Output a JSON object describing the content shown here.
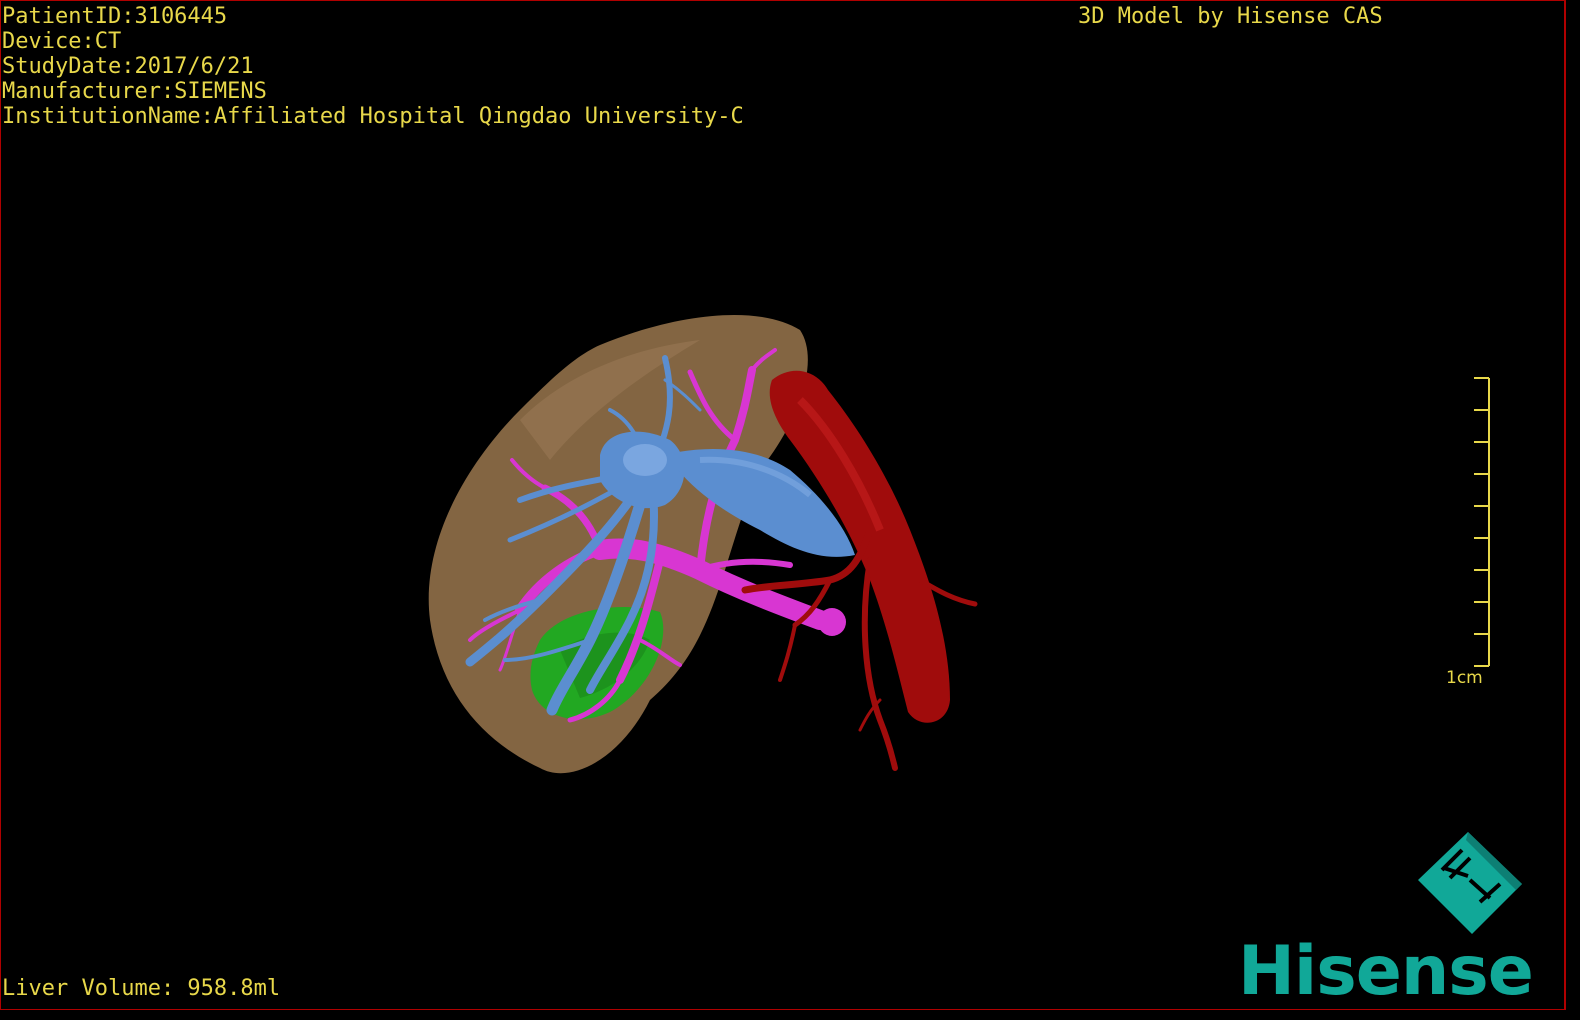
{
  "header": {
    "patient_id": "PatientID:3106445",
    "device": "Device:CT",
    "study_date": "StudyDate:2017/6/21",
    "manufacturer": "Manufacturer:SIEMENS",
    "institution": "InstitutionName:Affiliated Hospital Qingdao University-C"
  },
  "credit": "3D Model by Hisense CAS",
  "footer": {
    "liver_volume": "Liver Volume: 958.8ml"
  },
  "scale_bar": {
    "label": "1cm",
    "ticks": 10
  },
  "brand": {
    "name": "Hisense",
    "color": "#11a898"
  },
  "colors": {
    "liver": "#8a6a46",
    "artery": "#a00c0c",
    "hepatic_vein": "#5b8ed0",
    "portal_vein": "#d836d2",
    "gallbladder": "#22a822",
    "overlay_text": "#e8d84a"
  }
}
